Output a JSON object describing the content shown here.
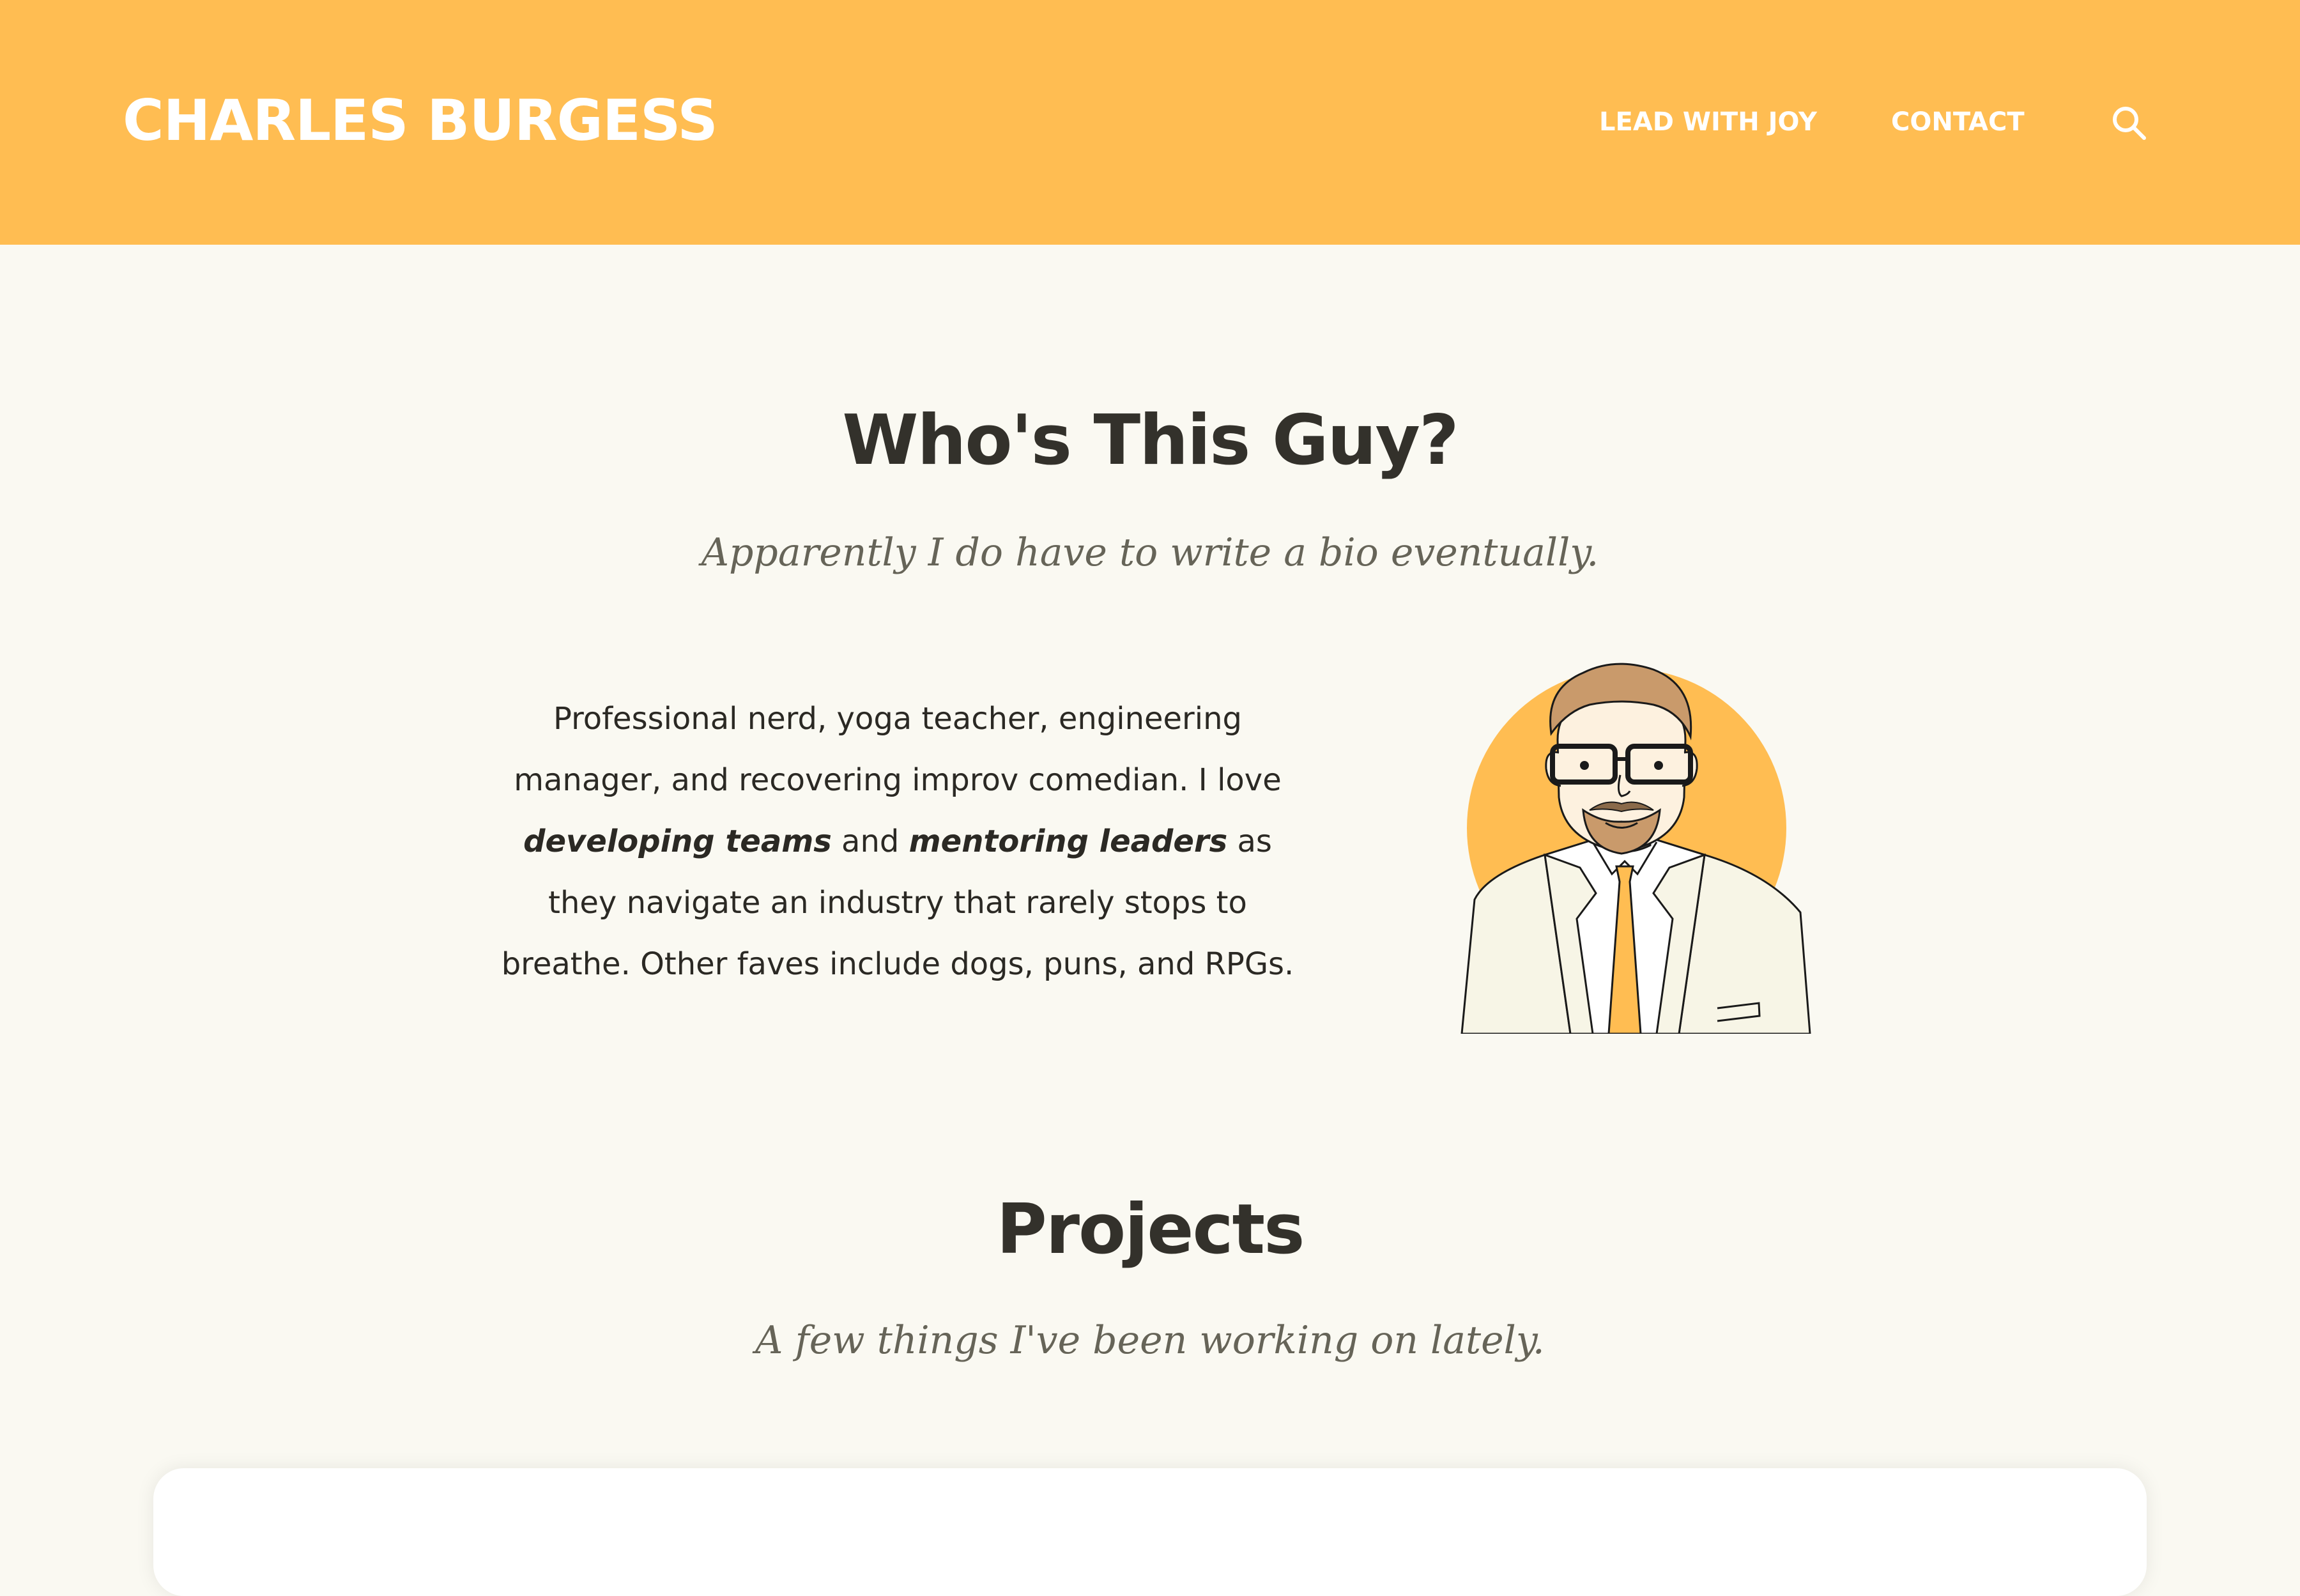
{
  "header": {
    "site_title": "CHARLES BURGESS",
    "nav": [
      {
        "label": "LEAD WITH JOY"
      },
      {
        "label": "CONTACT"
      }
    ],
    "search_icon": "search-icon"
  },
  "about": {
    "title": "Who's This Guy?",
    "subtitle": "Apparently I do have to write a bio eventually.",
    "bio": {
      "part1": "Professional nerd, yoga teacher, engineering manager, and recovering improv comedian. I love ",
      "emphasis1": "developing teams",
      "part2": " and ",
      "emphasis2": "mentoring leaders",
      "part3": " as they navigate an industry that rarely stops to breathe. Other faves include dogs, puns, and RPGs."
    },
    "portrait": "portrait-illustration"
  },
  "projects": {
    "title": "Projects",
    "subtitle": "A few things I've been working on lately."
  },
  "colors": {
    "accent": "#ffbd52",
    "background": "#faf9f2",
    "text": "#33312b",
    "subtitle": "#666458"
  }
}
